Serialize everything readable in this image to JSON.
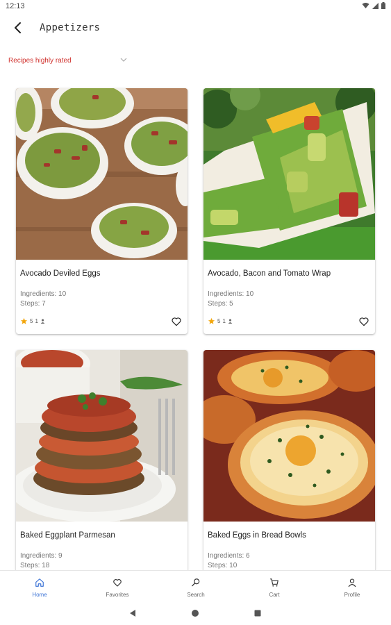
{
  "status": {
    "time": "12:13"
  },
  "header": {
    "title": "Appetizers"
  },
  "filter": {
    "label": "Recipes highly rated"
  },
  "recipes": [
    {
      "name": "Avocado Deviled Eggs",
      "ingredients": "Ingredients: 10",
      "steps": "Steps: 7",
      "rating": "5",
      "count": "1"
    },
    {
      "name": "Avocado, Bacon and Tomato Wrap",
      "ingredients": "Ingredients: 10",
      "steps": "Steps: 5",
      "rating": "5",
      "count": "1"
    },
    {
      "name": "Baked Eggplant Parmesan",
      "ingredients": "Ingredients: 9",
      "steps": "Steps: 18"
    },
    {
      "name": "Baked Eggs in Bread Bowls",
      "ingredients": "Ingredients: 6",
      "steps": "Steps: 10"
    }
  ],
  "nav": {
    "items": [
      {
        "label": "Home",
        "icon": "home-icon"
      },
      {
        "label": "Favorites",
        "icon": "heart-icon"
      },
      {
        "label": "Search",
        "icon": "search-icon"
      },
      {
        "label": "Cart",
        "icon": "cart-icon"
      },
      {
        "label": "Profile",
        "icon": "person-icon"
      }
    ],
    "active": "Home"
  },
  "colors": {
    "accent": "#3b73d6",
    "filter": "#d0312d",
    "star": "#f2a60c"
  }
}
